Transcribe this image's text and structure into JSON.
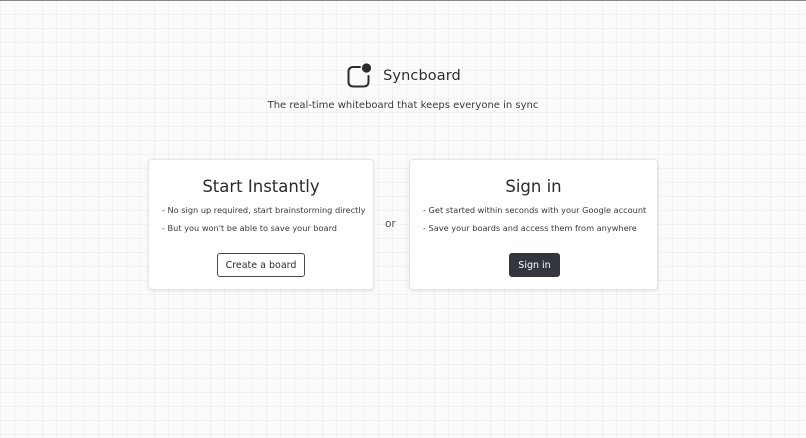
{
  "app": {
    "name": "Syncboard",
    "tagline": "The real-time whiteboard that keeps everyone in sync"
  },
  "logo": {
    "icon": "syncboard-logo-icon",
    "color": "#2b2b2b"
  },
  "cards": {
    "instant": {
      "title": "Start Instantly",
      "points": [
        "- No sign up required, start brainstorming directly",
        "- But you won't be able to save your board"
      ],
      "button_label": "Create a board"
    },
    "signin": {
      "title": "Sign in",
      "points": [
        "- Get started within seconds with your Google account",
        "- Save your boards and access them from anywhere"
      ],
      "button_label": "Sign in"
    }
  },
  "divider_label": "or",
  "colors": {
    "primary_button": "#33373d",
    "text": "#2b2b2b"
  }
}
